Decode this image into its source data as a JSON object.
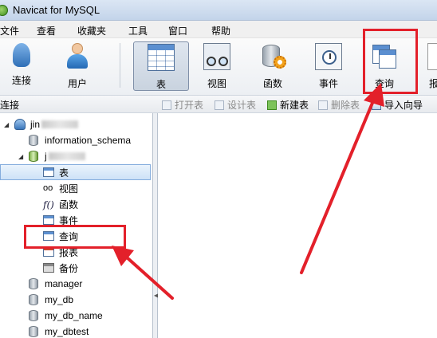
{
  "window": {
    "title": "Navicat for MySQL"
  },
  "menu": [
    "文件",
    "查看",
    "收藏夹",
    "工具",
    "窗口",
    "帮助"
  ],
  "toolbar": {
    "connect": "连接",
    "user": "用户",
    "table": "表",
    "view": "视图",
    "function": "函数",
    "event": "事件",
    "query": "查询",
    "report_partial": "报"
  },
  "subbar": {
    "connection_label": "连接",
    "open_table": "打开表",
    "design_table": "设计表",
    "new_table": "新建表",
    "delete_table": "删除表",
    "import_wizard": "导入向导"
  },
  "tree": {
    "connection_prefix": "jin",
    "db_open_prefix": "j",
    "information_schema": "information_schema",
    "objects": {
      "tables": "表",
      "views": "视图",
      "functions": "函数",
      "events": "事件",
      "queries": "查询",
      "reports": "报表",
      "backups": "备份"
    },
    "databases": [
      "manager",
      "my_db",
      "my_db_name",
      "my_dbtest"
    ]
  },
  "colors": {
    "annotation": "#e3202a",
    "selection": "#cde2f7"
  }
}
